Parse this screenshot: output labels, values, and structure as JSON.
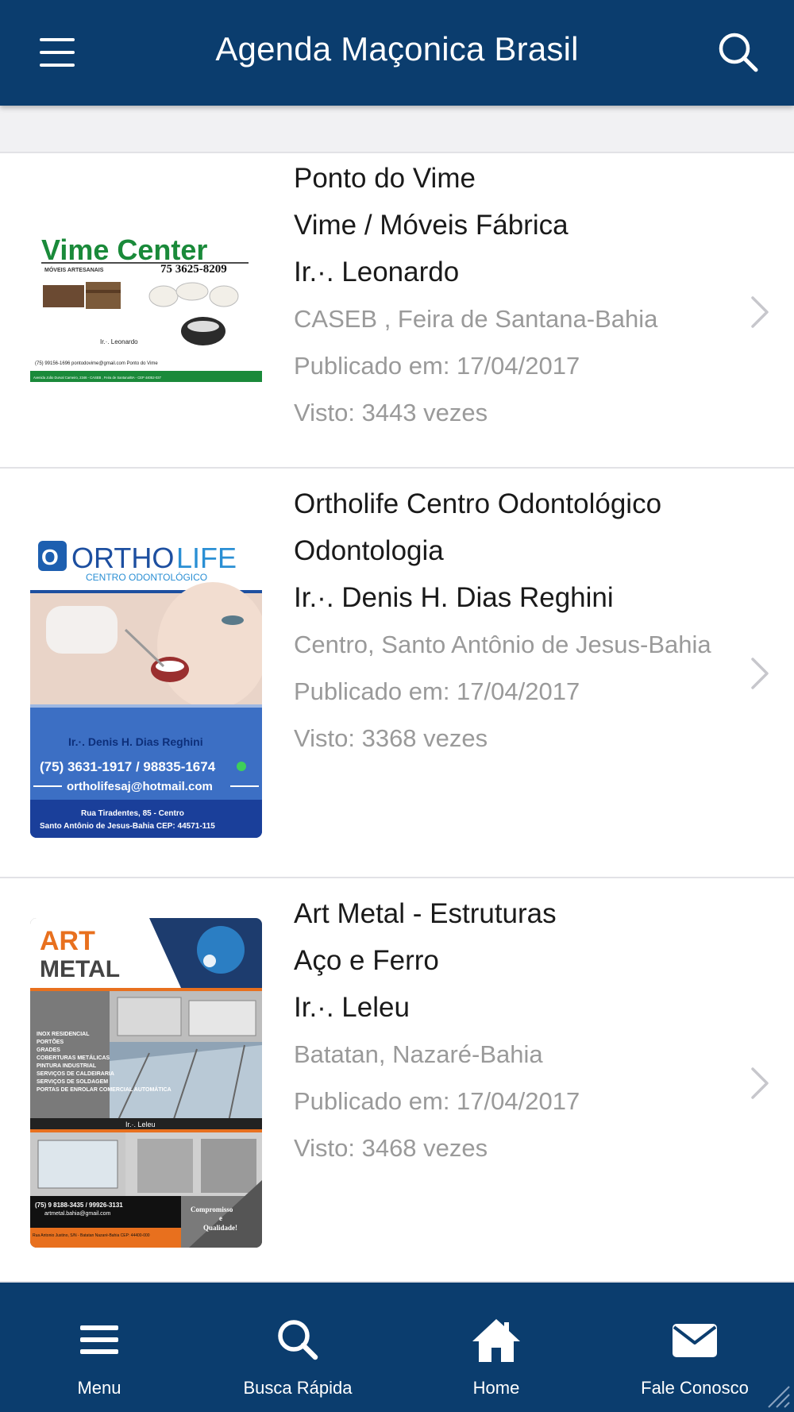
{
  "header": {
    "title": "Agenda Maçonica Brasil",
    "menu_icon": "hamburger-menu-icon",
    "search_icon": "search-icon"
  },
  "listings": [
    {
      "name": "Ponto do Vime",
      "category": "Vime / Móveis Fábrica",
      "person": "Ir.·. Leonardo",
      "location": "CASEB , Feira de Santana-Bahia",
      "published": "Publicado em: 17/04/2017",
      "views": "Visto: 3443 vezes",
      "thumb": {
        "title": "Vime Center",
        "subtitle": "MÓVEIS ARTESANAIS",
        "phone": "75 3625-8209",
        "person": "Ir.·. Leonardo",
        "contacts": "(75) 99156-1696   pontodovime@gmail.com   Ponto do Vime",
        "address": "Avenida João Durval Carneiro, 2346 - CASEB , Feira de Santana/BA - CEP 44052-037"
      }
    },
    {
      "name": "Ortholife Centro Odontológico",
      "category": "Odontologia",
      "person": "Ir.·. Denis H. Dias Reghini",
      "location": "Centro, Santo Antônio de Jesus-Bahia",
      "published": "Publicado em: 17/04/2017",
      "views": "Visto: 3368 vezes",
      "thumb": {
        "logo_a": "ORTHO",
        "logo_b": "LIFE",
        "subtitle": "CENTRO ODONTOLÓGICO",
        "person": "Ir.·. Denis H. Dias Reghini",
        "phone": "(75) 3631-1917 / 98835-1674",
        "email": "ortholifesaj@hotmail.com",
        "address1": "Rua Tiradentes, 85 - Centro",
        "address2": "Santo Antônio de Jesus-Bahia CEP: 44571-115"
      }
    },
    {
      "name": "Art Metal - Estruturas",
      "category": "Aço e Ferro",
      "person": "Ir.·. Leleu",
      "location": "Batatan, Nazaré-Bahia",
      "published": "Publicado em: 17/04/2017",
      "views": "Visto: 3468 vezes",
      "thumb": {
        "logo_a": "ART",
        "logo_b": "METAL",
        "services": [
          "INOX RESIDENCIAL",
          "PORTÕES",
          "GRADES",
          "COBERTURAS METÁLICAS",
          "PINTURA INDUSTRIAL",
          "SERVIÇOS DE CALDEIRARIA",
          "SERVIÇOS DE SOLDAGEM",
          "PORTAS DE ENROLAR COMERCIAL AUTOMÁTICA"
        ],
        "person": "Ir.·. Leleu",
        "phone": "(75) 9 8188-3435 / 99926-3131",
        "email": "artmetal.bahia@gmail.com",
        "tagline1": "Compromisso",
        "tagline2": "e",
        "tagline3": "Qualidade!",
        "address": "Rua Antonio Justino, S/N - Batatan Nazaré-Bahia CEP: 44400-000"
      }
    }
  ],
  "tabbar": {
    "tabs": [
      {
        "label": "Menu",
        "icon": "menu-icon"
      },
      {
        "label": "Busca Rápida",
        "icon": "search-icon"
      },
      {
        "label": "Home",
        "icon": "home-icon"
      },
      {
        "label": "Fale Conosco",
        "icon": "mail-icon"
      }
    ]
  },
  "colors": {
    "primary": "#0b3d6e",
    "secondary_text": "#9a9a9a",
    "divider": "#e2e2e6",
    "band": "#f1f1f3"
  }
}
